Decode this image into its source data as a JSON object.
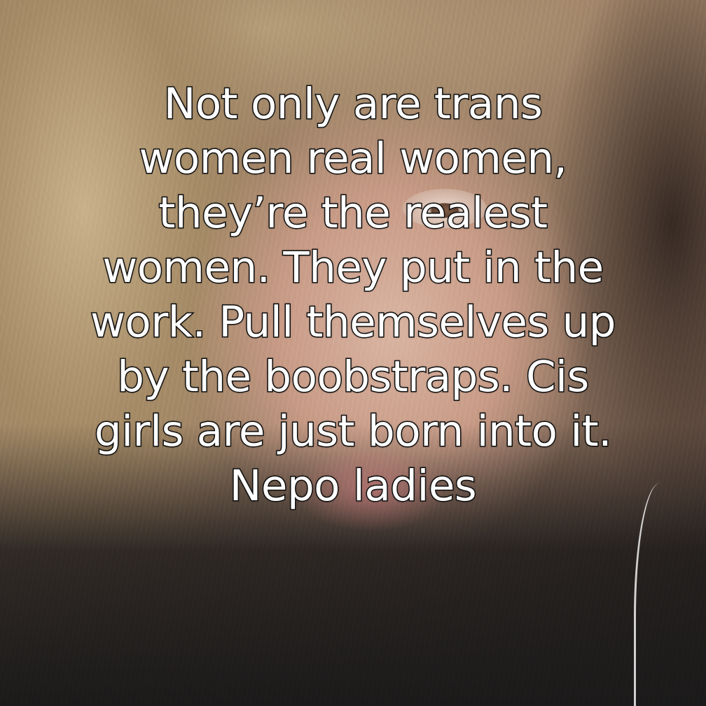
{
  "caption": {
    "lines": [
      "Not only are trans",
      "women real women,",
      "they’re the realest",
      "women. They put in the",
      "work. Pull themselves up",
      "by the boobstraps. Cis",
      "girls are just born into it.",
      "Nepo ladies"
    ]
  },
  "colors": {
    "text_fill": "#ffffff",
    "text_outline": "#111111"
  }
}
